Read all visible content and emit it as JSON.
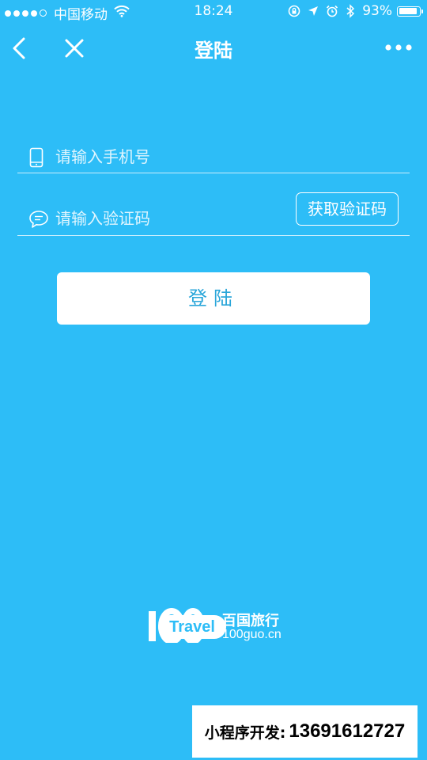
{
  "status_bar": {
    "carrier": "中国移动",
    "time": "18:24",
    "battery_percent": "93%",
    "battery_level": 0.93,
    "signal_bars_filled": 4,
    "signal_bars_total": 5,
    "icons": [
      "signal-dots-icon",
      "wifi-icon",
      "orientation-lock-icon",
      "location-arrow-icon",
      "alarm-clock-icon",
      "bluetooth-icon",
      "battery-icon"
    ]
  },
  "nav": {
    "title": "登陆",
    "icons": [
      "back-chevron-icon",
      "close-icon",
      "more-dots-icon"
    ]
  },
  "form": {
    "phone_placeholder": "请输入手机号",
    "phone_value": "",
    "code_placeholder": "请输入验证码",
    "code_value": "",
    "get_code_label": "获取验证码",
    "login_label": "登陆",
    "icons": [
      "mobile-phone-icon",
      "chat-bubble-icon"
    ]
  },
  "logo": {
    "travel_text": "Travel",
    "brand_name": "百国旅行",
    "domain": "100guo.cn"
  },
  "banner": {
    "label": "小程序开发:",
    "phone": "13691612727"
  },
  "colors": {
    "background": "#2dbdf7",
    "login_button_text": "#2aa6d9",
    "white": "#ffffff"
  }
}
